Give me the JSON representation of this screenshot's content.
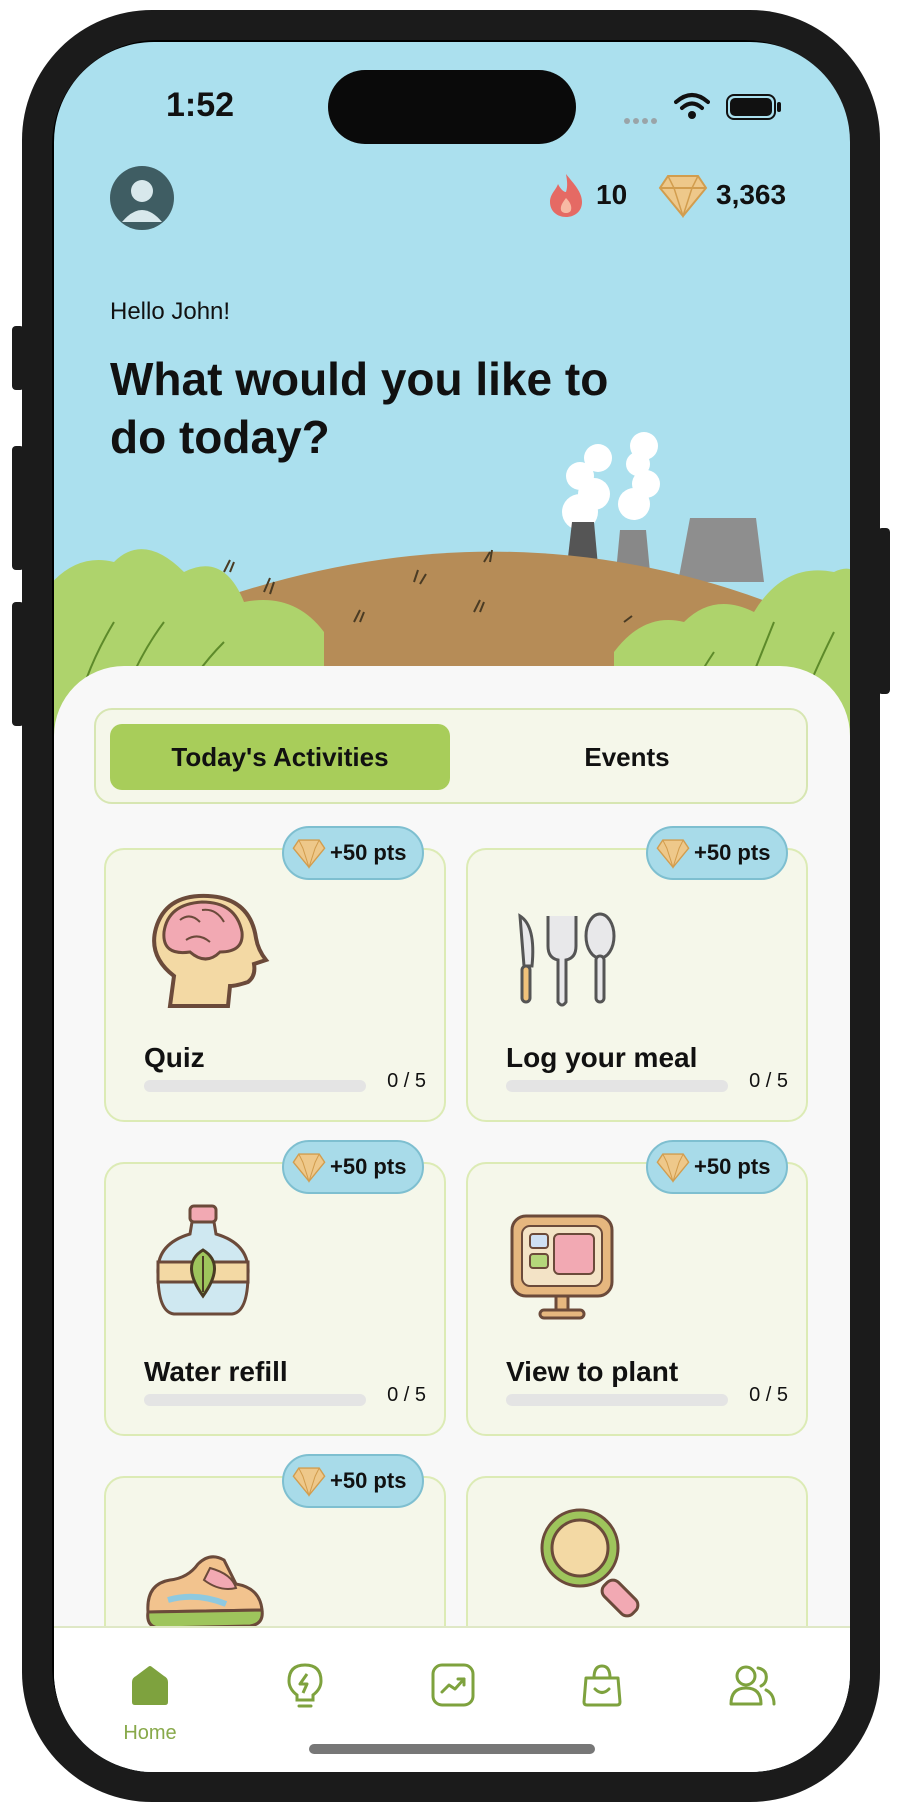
{
  "status_bar": {
    "time": "1:52"
  },
  "header": {
    "streak": "10",
    "points": "3,363",
    "greeting": "Hello John!",
    "headline": "What would you like to do today?"
  },
  "tabs": [
    {
      "label": "Today's Activities",
      "active": true
    },
    {
      "label": "Events",
      "active": false
    }
  ],
  "activities": [
    {
      "title": "Quiz",
      "reward": "+50 pts",
      "progress": "0 / 5",
      "progress_fraction": 0,
      "icon": "brain-head-icon"
    },
    {
      "title": "Log your meal",
      "reward": "+50 pts",
      "progress": "0 / 5",
      "progress_fraction": 0,
      "icon": "cutlery-icon"
    },
    {
      "title": "Water refill",
      "reward": "+50 pts",
      "progress": "0 / 5",
      "progress_fraction": 0,
      "icon": "water-bottle-icon"
    },
    {
      "title": "View to plant",
      "reward": "+50 pts",
      "progress": "0 / 5",
      "progress_fraction": 0,
      "icon": "monitor-icon"
    },
    {
      "title": "",
      "reward": "+50 pts",
      "icon": "sneaker-icon"
    },
    {
      "title": "",
      "icon": "magnifier-icon"
    }
  ],
  "nav": [
    {
      "label": "Home",
      "icon": "home-icon",
      "active": true
    },
    {
      "label": "",
      "icon": "lightbulb-icon"
    },
    {
      "label": "",
      "icon": "chart-icon"
    },
    {
      "label": "",
      "icon": "shopping-bag-icon"
    },
    {
      "label": "",
      "icon": "friends-icon"
    }
  ],
  "colors": {
    "sky": "#abe0ee",
    "accent_green": "#a8cd5a",
    "badge_blue": "#a8dbe9",
    "card_bg": "#f5f7ea",
    "nav_green": "#88a94a"
  }
}
